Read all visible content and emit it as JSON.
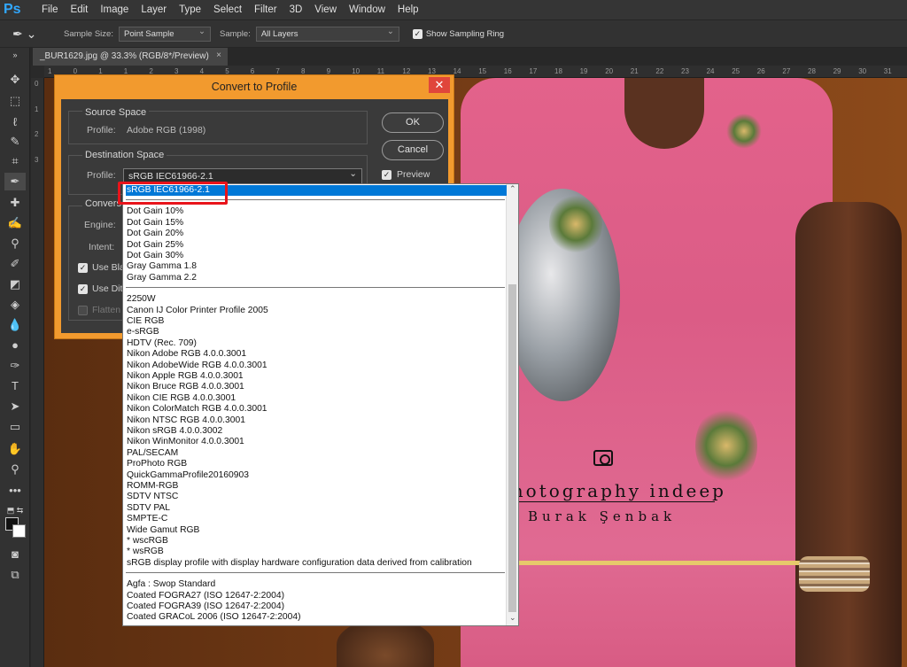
{
  "app": {
    "logo": "Ps"
  },
  "menu": [
    "File",
    "Edit",
    "Image",
    "Layer",
    "Type",
    "Select",
    "Filter",
    "3D",
    "View",
    "Window",
    "Help"
  ],
  "options": {
    "sample_size_label": "Sample Size:",
    "sample_size_value": "Point Sample",
    "sample_label": "Sample:",
    "sample_value": "All Layers",
    "show_ring_label": "Show Sampling Ring"
  },
  "document": {
    "tab_title": "_BUR1629.jpg @ 33.3% (RGB/8*/Preview)",
    "close": "×"
  },
  "ruler": {
    "h": [
      "1",
      "0",
      "1",
      "1",
      "2",
      "3",
      "4",
      "5",
      "6",
      "7",
      "8",
      "9",
      "10",
      "11",
      "12",
      "13",
      "14",
      "15",
      "16",
      "17",
      "18",
      "19",
      "20",
      "21",
      "22",
      "23",
      "24",
      "25",
      "26",
      "27",
      "28",
      "29",
      "30",
      "31"
    ],
    "v": [
      "0",
      "1",
      "2",
      "3"
    ]
  },
  "dialog": {
    "title": "Convert to Profile",
    "close": "✕",
    "source_space": "Source Space",
    "source_profile_label": "Profile:",
    "source_profile_value": "Adobe RGB (1998)",
    "destination_space": "Destination Space",
    "dest_profile_label": "Profile:",
    "dest_profile_value": "sRGB IEC61966-2.1",
    "conversion_partial": "Convers",
    "engine_partial": "Engine:",
    "intent_partial": "Intent:",
    "use_black_partial": "Use Bla",
    "use_dither_partial": "Use Dit",
    "flatten_partial": "Flatten",
    "ok": "OK",
    "cancel": "Cancel",
    "preview": "Preview"
  },
  "dropdown": {
    "selected": "sRGB IEC61966-2.1",
    "group1": [
      "Dot Gain 10%",
      "Dot Gain 15%",
      "Dot Gain 20%",
      "Dot Gain 25%",
      "Dot Gain 30%",
      "Gray Gamma 1.8",
      "Gray Gamma 2.2"
    ],
    "group2": [
      "2250W",
      "Canon IJ Color Printer Profile 2005",
      "CIE RGB",
      "e-sRGB",
      "HDTV (Rec. 709)",
      "Nikon Adobe RGB 4.0.0.3001",
      "Nikon AdobeWide RGB 4.0.0.3001",
      "Nikon Apple RGB 4.0.0.3001",
      "Nikon Bruce RGB 4.0.0.3001",
      "Nikon CIE RGB 4.0.0.3001",
      "Nikon ColorMatch RGB 4.0.0.3001",
      "Nikon NTSC RGB 4.0.0.3001",
      "Nikon sRGB 4.0.0.3002",
      "Nikon WinMonitor 4.0.0.3001",
      "PAL/SECAM",
      "ProPhoto RGB",
      "QuickGammaProfile20160903",
      "ROMM-RGB",
      "SDTV NTSC",
      "SDTV PAL",
      "SMPTE-C",
      "Wide Gamut RGB",
      "* wscRGB",
      "* wsRGB",
      "sRGB display profile with display hardware configuration data derived from calibration"
    ],
    "group3": [
      "Agfa : Swop Standard",
      "Coated FOGRA27 (ISO 12647-2:2004)",
      "Coated FOGRA39 (ISO 12647-2:2004)",
      "Coated GRACoL 2006 (ISO 12647-2:2004)"
    ]
  },
  "watermark": {
    "line1": "photography indeep",
    "line2": "Burak Şenbak"
  }
}
